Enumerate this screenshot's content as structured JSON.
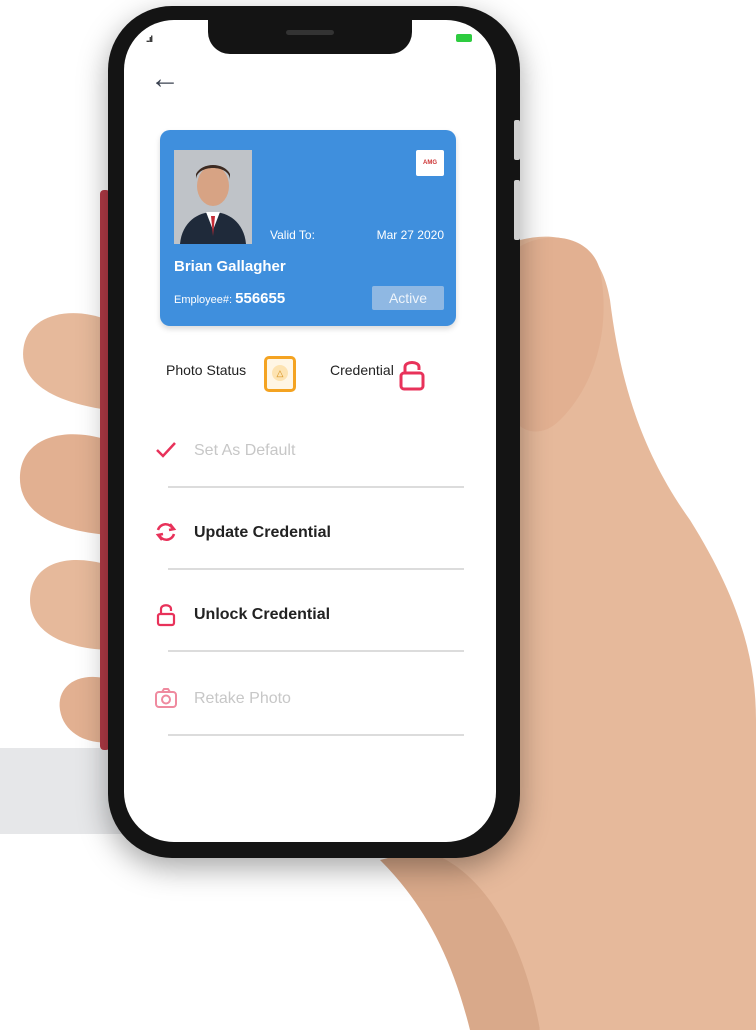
{
  "status_bar": {
    "signal": "..ıl",
    "battery": "EXE"
  },
  "card": {
    "valid_label": "Valid To:",
    "valid_date": "Mar 27 2020",
    "name": "Brian Gallagher",
    "employee_label": "Employee#:",
    "employee_number": "556655",
    "status": "Active",
    "logo_text": "AMG",
    "colors": {
      "card": "#3f8fdd",
      "active_badge": "#8fb8e3"
    }
  },
  "status_row": {
    "photo_status_label": "Photo Status",
    "photo_status_icon": "warning-bell-icon",
    "credential_label": "Credential",
    "credential_icon": "unlocked-padlock-icon"
  },
  "actions": [
    {
      "label": "Set As Default",
      "icon": "checkmark-icon",
      "enabled": false
    },
    {
      "label": "Update Credential",
      "icon": "refresh-icon",
      "enabled": true
    },
    {
      "label": "Unlock Credential",
      "icon": "padlock-icon",
      "enabled": true
    },
    {
      "label": "Retake Photo",
      "icon": "camera-icon",
      "enabled": false
    }
  ],
  "colors": {
    "accent": "#e8325a",
    "warning": "#f4a321",
    "disabled": "#c7c7c7"
  }
}
